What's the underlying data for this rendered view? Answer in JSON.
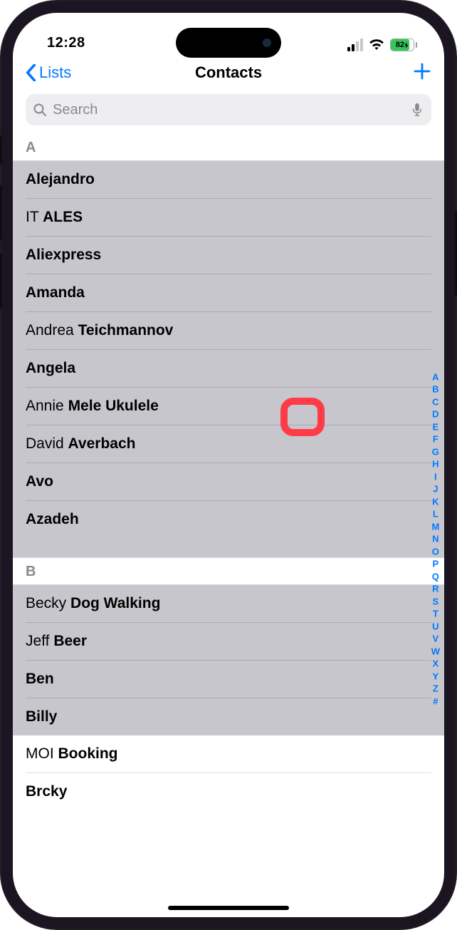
{
  "status": {
    "time": "12:28",
    "battery_pct": "82"
  },
  "nav": {
    "back_label": "Lists",
    "title": "Contacts"
  },
  "search": {
    "placeholder": "Search"
  },
  "sections": {
    "a": {
      "letter": "A"
    },
    "b": {
      "letter": "B"
    }
  },
  "contacts_a": [
    {
      "first": "",
      "last": "Alejandro"
    },
    {
      "first": "IT",
      "last": "ALES"
    },
    {
      "first": "",
      "last": "Aliexpress"
    },
    {
      "first": "",
      "last": "Amanda"
    },
    {
      "first": "Andrea",
      "last": "Teichmannov"
    },
    {
      "first": "",
      "last": "Angela"
    },
    {
      "first": "Annie",
      "last": "Mele Ukulele"
    },
    {
      "first": "David",
      "last": "Averbach"
    },
    {
      "first": "",
      "last": "Avo"
    },
    {
      "first": "",
      "last": "Azadeh"
    }
  ],
  "contacts_b": [
    {
      "first": "Becky",
      "last": "Dog Walking"
    },
    {
      "first": "Jeff",
      "last": "Beer"
    },
    {
      "first": "",
      "last": "Ben"
    },
    {
      "first": "",
      "last": "Billy"
    },
    {
      "first": "MOI",
      "last": "Booking"
    },
    {
      "first": "",
      "last": "Brcky"
    }
  ],
  "index": [
    "A",
    "B",
    "C",
    "D",
    "E",
    "F",
    "G",
    "H",
    "I",
    "J",
    "K",
    "L",
    "M",
    "N",
    "O",
    "P",
    "Q",
    "R",
    "S",
    "T",
    "U",
    "V",
    "W",
    "X",
    "Y",
    "Z",
    "#"
  ]
}
